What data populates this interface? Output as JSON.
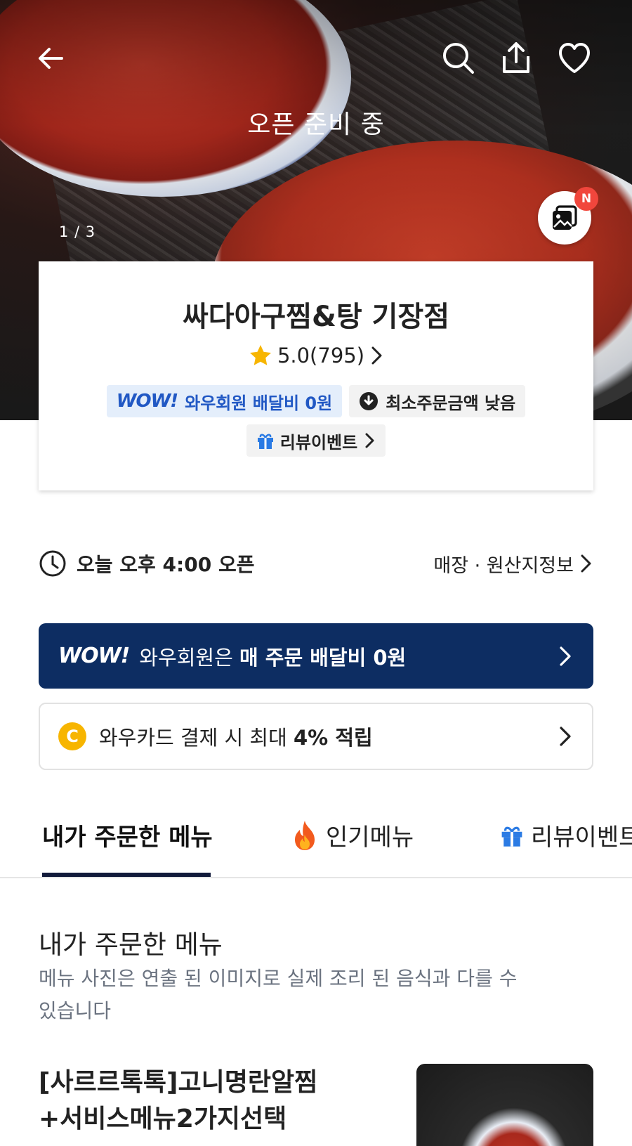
{
  "hero": {
    "status": "오픈 준비 중",
    "counter": "1 / 3",
    "new_badge": "N"
  },
  "store": {
    "name": "싸다아구찜&탕 기장점",
    "rating": "5.0(795)",
    "wow_badge_logo": "WOW!",
    "wow_badge_text": "와우회원 배달비 0원",
    "min_order_text": "최소주문금액 낮음",
    "review_event": "리뷰이벤트"
  },
  "hours": {
    "text_prefix": "오늘 오후 ",
    "time": "4:00",
    "text_suffix": " 오픈",
    "info_link": "매장 · 원산지정보"
  },
  "wow_banner": {
    "logo": "WOW!",
    "text_normal": "와우회원은 ",
    "text_bold": "매 주문 배달비 0원"
  },
  "card_promo": {
    "coin": "C",
    "text_normal": "와우카드 결제 시 최대 ",
    "text_bold": "4% 적립"
  },
  "tabs": [
    {
      "label": "내가 주문한 메뉴"
    },
    {
      "label": "인기메뉴"
    },
    {
      "label": "리뷰이벤트"
    }
  ],
  "section": {
    "title": "내가 주문한 메뉴",
    "note": "메뉴 사진은 연출 된 이미지로 실제 조리 된 음식과 다를 수 있습니다"
  },
  "menu_item": {
    "name": "[사르르톡톡]고니명란알찜 +서비스메뉴2가지선택"
  },
  "colors": {
    "wow_navy": "#0d2d62",
    "wow_blue": "#2158c4",
    "coin_yellow": "#f7b500",
    "badge_red": "#f1463c",
    "star": "#f7b500"
  }
}
